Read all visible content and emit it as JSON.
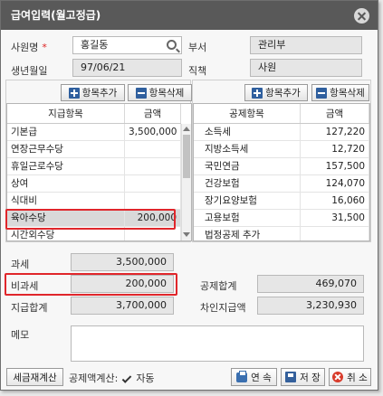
{
  "dialog": {
    "title": "급여입력(월고정급)"
  },
  "employee": {
    "name_label": "사원명",
    "required_mark": "*",
    "name_value": "홍길동",
    "birth_label": "생년월일",
    "birth_value": "97/06/21",
    "dept_label": "부서",
    "dept_value": "관리부",
    "position_label": "직책",
    "position_value": "사원"
  },
  "toolbar": {
    "add_label": "항목추가",
    "delete_label": "항목삭제"
  },
  "pay_grid": {
    "headers": [
      "지급항목",
      "금액"
    ],
    "rows": [
      {
        "item": "기본급",
        "amount": "3,500,000"
      },
      {
        "item": "연장근무수당",
        "amount": ""
      },
      {
        "item": "휴일근로수당",
        "amount": ""
      },
      {
        "item": "상여",
        "amount": ""
      },
      {
        "item": "식대비",
        "amount": ""
      },
      {
        "item": "육아수당",
        "amount": "200,000"
      },
      {
        "item": "시간외수당",
        "amount": ""
      }
    ]
  },
  "deduct_grid": {
    "headers": [
      "공제항목",
      "금액"
    ],
    "rows": [
      {
        "item": "소득세",
        "amount": "127,220"
      },
      {
        "item": "지방소득세",
        "amount": "12,720"
      },
      {
        "item": "국민연금",
        "amount": "157,500"
      },
      {
        "item": "건강보험",
        "amount": "124,070"
      },
      {
        "item": "장기요양보험",
        "amount": "16,060"
      },
      {
        "item": "고용보험",
        "amount": "31,500"
      },
      {
        "item": "법정공제 추가",
        "amount": ""
      }
    ]
  },
  "summary": {
    "taxable_label": "과세",
    "taxable_value": "3,500,000",
    "nontaxable_label": "비과세",
    "nontaxable_value": "200,000",
    "pay_total_label": "지급합계",
    "pay_total_value": "3,700,000",
    "deduct_total_label": "공제합계",
    "deduct_total_value": "469,070",
    "net_pay_label": "차인지급액",
    "net_pay_value": "3,230,930"
  },
  "memo": {
    "label": "메모",
    "value": ""
  },
  "footer": {
    "recalc_label": "세금재계산",
    "auto_calc_label": "공제액계산:",
    "auto_label": "자동",
    "continue_label": "연 속",
    "save_label": "저 장",
    "cancel_label": "취 소"
  },
  "colors": {
    "titlebar": "#595959",
    "highlight": "#e0262b",
    "icon_blue": "#2f5f9e"
  }
}
